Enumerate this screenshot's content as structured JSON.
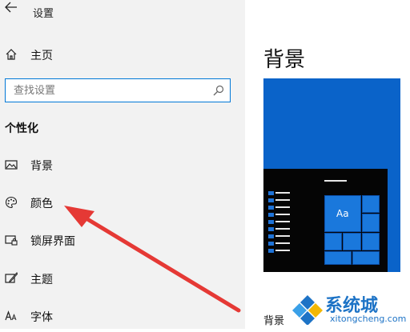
{
  "window": {
    "title": "设置"
  },
  "sidebar": {
    "home_label": "主页",
    "search": {
      "placeholder": "查找设置"
    },
    "section_heading": "个性化",
    "items": [
      {
        "label": "背景",
        "icon": "picture-icon"
      },
      {
        "label": "颜色",
        "icon": "palette-icon"
      },
      {
        "label": "锁屏界面",
        "icon": "lock-screen-icon"
      },
      {
        "label": "主题",
        "icon": "theme-brush-icon"
      },
      {
        "label": "字体",
        "icon": "font-icon"
      }
    ]
  },
  "content": {
    "title": "背景",
    "preview_tile_text": "Aa",
    "bottom_label": "背景"
  },
  "watermark": {
    "text": "系统城",
    "sub": "xitongcheng.com"
  },
  "colors": {
    "accent": "#0078d7",
    "arrow": "#e53935",
    "preview_bg": "#0a63c9",
    "watermark": "#1d73c6"
  }
}
